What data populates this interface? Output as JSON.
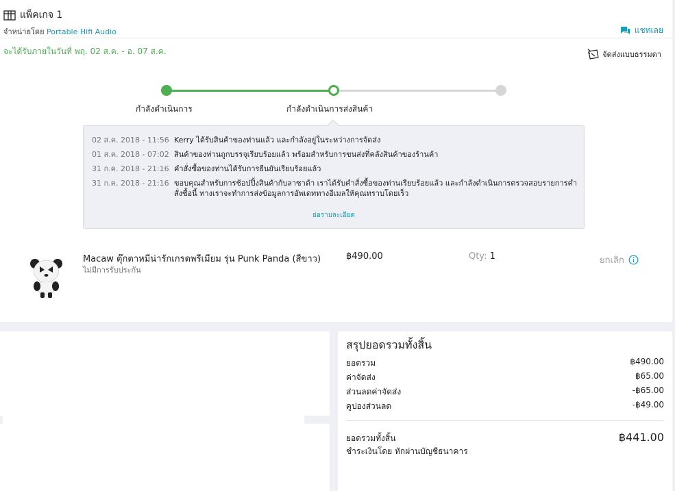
{
  "package": {
    "title": "แพ็คเกจ 1",
    "seller_prefix": "จำหน่ายโดย",
    "seller_name": "Portable Hifi Audio",
    "chat_label": "แชทเลย"
  },
  "delivery": {
    "eta": "จะได้รับภายในวันที่ พฤ. 02 ส.ค. - อ. 07 ส.ค.",
    "method": "จัดส่งแบบธรรมดา"
  },
  "progress": {
    "steps": [
      {
        "label": "กำลังดำเนินการ"
      },
      {
        "label": "กำลังดำเนินการส่งสินค้า"
      },
      {
        "label": ""
      }
    ],
    "current_step": 2
  },
  "timeline": {
    "events": [
      {
        "time": "02 ส.ค. 2018 - 11:56",
        "text": "Kerry ได้รับสินค้าของท่านแล้ว และกำลังอยู่ในระหว่างการจัดส่ง"
      },
      {
        "time": "01 ส.ค. 2018 - 07:02",
        "text": "สินค้าของท่านถูกบรรจุเรียบร้อยแล้ว พร้อมสำหรับการขนส่งที่คลังสินค้าของร้านค้า"
      },
      {
        "time": "31 ก.ค. 2018 - 21:16",
        "text": "คำสั่งซื้อของท่านได้รับการยืนยันเรียบร้อยแล้ว"
      },
      {
        "time": "31 ก.ค. 2018 - 21:16",
        "text": "ขอบคุณสำหรับการช้อปปิ้งสินค้ากับลาซาด้า เราได้รับคำสั่งซื้อของท่านเรียบร้อยแล้ว และกำลังดำเนินการตรวจสอบรายการคำสั่งซื้อนี้ ทางเราจะทำการส่งข้อมูลการอัพเดททางอีเมลให้คุณทราบโดยเร็ว"
      }
    ],
    "collapse_label": "ย่อรายละเอียด"
  },
  "item": {
    "name": "Macaw ตุ๊กตาหมีน่ารักเกรดพรีเมียม รุ่น Punk Panda (สีขาว)",
    "warranty": "ไม่มีการรับประกัน",
    "price": "฿490.00",
    "qty_label": "Qty:",
    "qty_value": "1",
    "cancel_label": "ยกเลิก"
  },
  "summary": {
    "title": "สรุปยอดรวมทั้งสิ้น",
    "rows": [
      {
        "label": "ยอดรวม",
        "value": "฿490.00"
      },
      {
        "label": "ค่าจัดส่ง",
        "value": "฿65.00"
      },
      {
        "label": "ส่วนลดค่าจัดส่ง",
        "value": "-฿65.00"
      },
      {
        "label": "คูปองส่วนลด",
        "value": "-฿49.00"
      }
    ],
    "total_label": "ยอดรวมทั้งสิ้น",
    "total_value": "฿441.00",
    "payment": "ชำระเงินโดย หักผ่านบัญชีธนาคาร"
  },
  "colors": {
    "accent": "#1a9cb7",
    "success": "#4caf50",
    "muted": "#9e9e9e",
    "background": "#eff0f5"
  }
}
